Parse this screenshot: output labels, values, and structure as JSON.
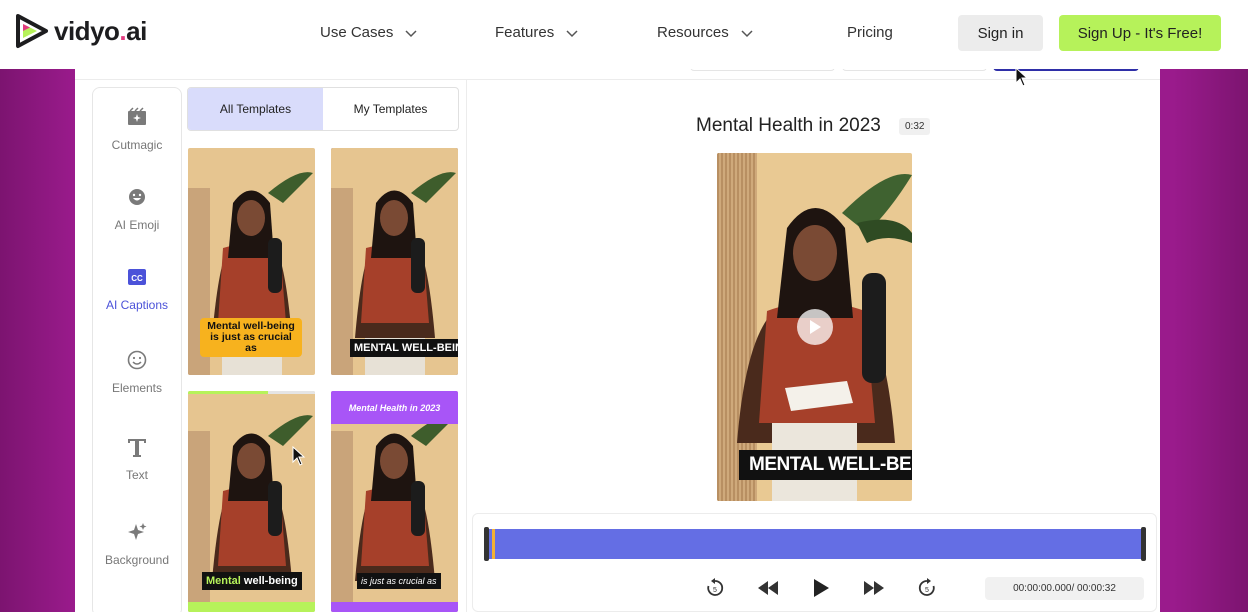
{
  "brand": {
    "name_part1": "vidyo",
    "name_dot": ".",
    "name_part2": "ai",
    "accent": "#b6f25a"
  },
  "nav": {
    "items": [
      {
        "label": "Use Cases",
        "dropdown": true
      },
      {
        "label": "Features",
        "dropdown": true
      },
      {
        "label": "Resources",
        "dropdown": true
      },
      {
        "label": "Pricing",
        "dropdown": false
      }
    ],
    "signin_label": "Sign in",
    "signup_label": "Sign Up - It's Free!"
  },
  "tools": [
    {
      "label": "Cutmagic",
      "icon": "cutmagic-icon",
      "active": false
    },
    {
      "label": "AI Emoji",
      "icon": "emoji-icon",
      "active": false
    },
    {
      "label": "AI Captions",
      "icon": "captions-icon",
      "active": true
    },
    {
      "label": "Elements",
      "icon": "elements-icon",
      "active": false
    },
    {
      "label": "Text",
      "icon": "text-icon",
      "active": false
    },
    {
      "label": "Background",
      "icon": "background-icon",
      "active": false
    }
  ],
  "templates": {
    "tabs": [
      {
        "label": "All Templates",
        "active": true
      },
      {
        "label": "My Templates",
        "active": false
      }
    ],
    "items": [
      {
        "caption": "Mental well-being is just as crucial as",
        "style": "yellow-box"
      },
      {
        "caption": "MENTAL WELL-BEING",
        "style": "black-box",
        "selected": true
      },
      {
        "caption_highlight": "Mental",
        "caption_rest": " well-being",
        "style": "highlight-green",
        "progress": 0.63
      },
      {
        "title": "Mental Health in 2023",
        "caption": "is just as crucial as",
        "style": "purple-title"
      }
    ]
  },
  "preview": {
    "title": "Mental Health in 2023",
    "duration": "0:32",
    "caption": "MENTAL WELL-BEING",
    "timecode": "00:00:00.000/ 00:00:32"
  }
}
